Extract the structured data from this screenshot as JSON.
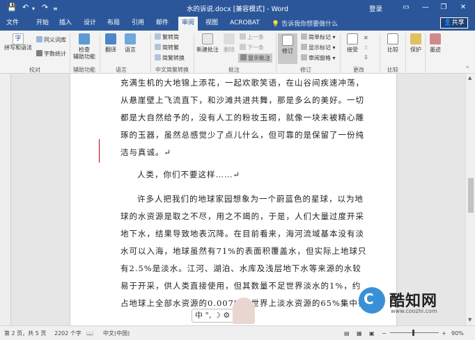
{
  "titlebar": {
    "title": "水的诉说.docx [兼容模式] - Word",
    "login": "登录",
    "save_icon": "save-icon",
    "undo_icon": "undo-icon",
    "redo_icon": "redo-icon",
    "minimize": "—",
    "restore": "❐",
    "close": "✕",
    "ribbon_opts": "▭"
  },
  "tabs": [
    "文件",
    "开始",
    "插入",
    "设计",
    "布局",
    "引用",
    "邮件",
    "审阅",
    "视图",
    "ACROBAT"
  ],
  "active_tab": "审阅",
  "tellme": "告诉我你想要做什么",
  "share": "共享",
  "ribbon": {
    "proofing": {
      "spell": "拼写和语法",
      "thesaurus": "同义词库",
      "wordcount": "字数统计",
      "label": "校对"
    },
    "accessibility": {
      "check1": "检查",
      "check2": "辅助功能",
      "label": "辅助功能"
    },
    "language": {
      "translate": "翻译",
      "language": "语言",
      "label": "语言"
    },
    "chinese": {
      "t2s": "繁转简",
      "s2t": "简转繁",
      "convert": "简繁转换",
      "label": "中文简繁转换"
    },
    "comments": {
      "new": "新建批注",
      "delete": "删除",
      "prev": "上一条",
      "next": "下一条",
      "show": "显示批注",
      "label": "批注"
    },
    "tracking": {
      "track": "修订",
      "markup": "简单标记",
      "show_markup": "显示标记",
      "pane": "审阅窗格",
      "label": "修订"
    },
    "changes": {
      "accept": "接受",
      "label": "更改"
    },
    "compare": {
      "compare": "比较",
      "label": "比较"
    },
    "protect": {
      "protect": "保护"
    },
    "ink": {
      "ink": "墨迹"
    }
  },
  "document": {
    "lines": [
      "充满生机的大地锦上添花，一起欢歌笑语，在山谷间疾速冲荡，",
      "从悬崖壁上飞流直下，和沙滩共进共舞，那是多么的美好。一切",
      "都是大自然给予的，没有人工的粉妆玉砌，就像一块未被精心雕",
      "琢的玉器，虽然总感觉少了点儿什么，但可靠的是保留了一份纯",
      "洁与真诚。↵",
      "人类，你们不要这样……↵",
      "许多人把我们的地球家园想象为一个蔚蓝色的星球，以为地",
      "球的水资源是取之不尽，用之不竭的，于是，人们大量过度开采",
      "地下水，结果导致地表沉降。在目前看来，海河流域基本没有淡",
      "水可以入海，地球虽然有71%的表面积覆盖水，但实际上地球只",
      "有2.5%是淡水。江河、湖泊、水库及浅层地下水等来源的水较",
      "易于开采，供人类直接使用，但其数量不足世界淡水的1%，约",
      "占地球上全部水资源的0.007%。世界上淡水资源的65%集中在十"
    ]
  },
  "ime": {
    "text": "中 °, ☽ ⚙"
  },
  "watermark": {
    "title": "酷知网",
    "url": "www.coozhi.com",
    "logo": "C"
  },
  "status": {
    "page": "第 2 页，共 5 页",
    "words": "2202 个字",
    "lang": "中文(中国)",
    "zoom": "90%"
  },
  "colors": {
    "accent": "#2b579a",
    "track_bar": "#c00000"
  }
}
